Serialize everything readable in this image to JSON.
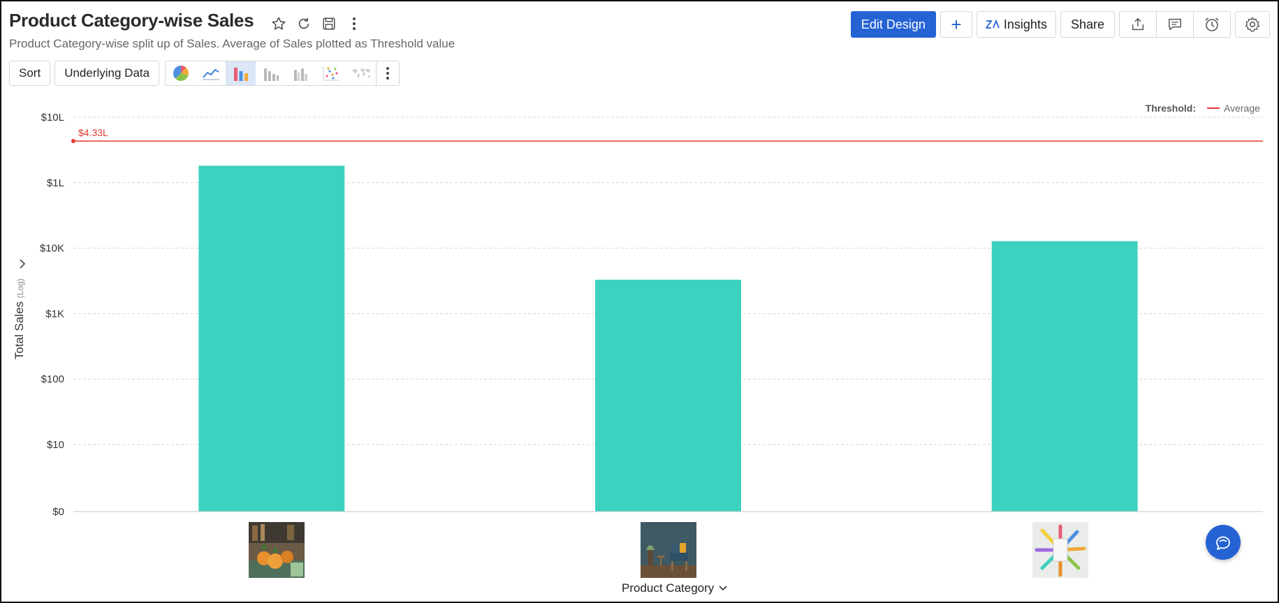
{
  "header": {
    "title": "Product Category-wise Sales",
    "subtitle": "Product Category-wise split up of Sales. Average of Sales plotted as Threshold value",
    "title_icons": [
      "star-icon",
      "refresh-icon",
      "save-icon",
      "more-vertical-icon"
    ]
  },
  "toolbar": {
    "sort_label": "Sort",
    "underlying_label": "Underlying Data",
    "chart_types": [
      "pie-chart-icon",
      "line-chart-icon",
      "bar-chart-icon",
      "stacked-bar-icon",
      "grouped-bar-icon",
      "scatter-chart-icon",
      "map-chart-icon"
    ],
    "active_chart_type": "bar-chart-icon"
  },
  "actions": {
    "edit_design_label": "Edit Design",
    "add_label": "+",
    "insights_label": "Insights",
    "share_label": "Share",
    "icons": [
      "export-icon",
      "comment-icon",
      "alarm-icon",
      "settings-icon"
    ]
  },
  "threshold_legend": {
    "label": "Threshold:",
    "item": "Average"
  },
  "colors": {
    "bar": "#3dd1bf",
    "threshold": "#e53935",
    "primary": "#2563d4"
  },
  "chart_data": {
    "type": "bar",
    "scale": "log",
    "categories": [
      "",
      "",
      ""
    ],
    "values": [
      182000,
      3300,
      12800
    ],
    "threshold": {
      "name": "Average",
      "value": 433000,
      "label": "$4.33L"
    },
    "yticks": [
      {
        "value": 0,
        "label": "$0"
      },
      {
        "value": 10,
        "label": "$10"
      },
      {
        "value": 100,
        "label": "$100"
      },
      {
        "value": 1000,
        "label": "$1K"
      },
      {
        "value": 10000,
        "label": "$10K"
      },
      {
        "value": 100000,
        "label": "$1L"
      },
      {
        "value": 1000000,
        "label": "$10L"
      }
    ],
    "xlabel": "Product Category",
    "ylabel": "Total Sales",
    "ylabel_suffix": "(Log)",
    "grid": true,
    "legend_position": "top-right"
  }
}
